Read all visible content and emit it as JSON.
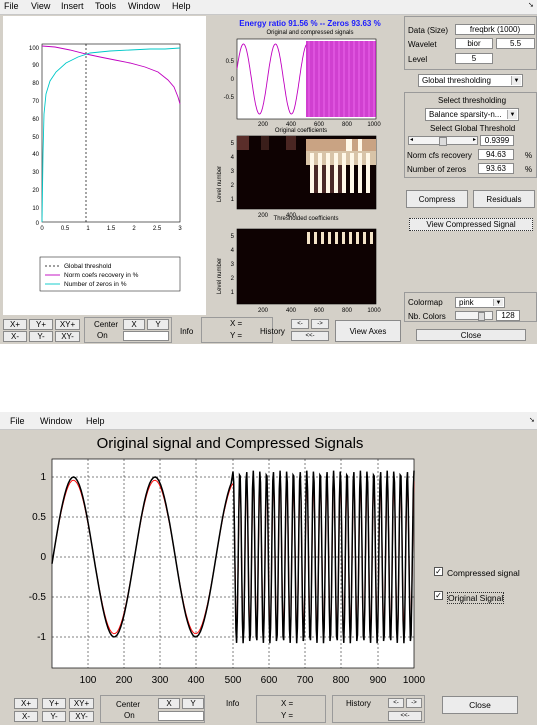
{
  "window1": {
    "menu": [
      "File",
      "View",
      "Insert",
      "Tools",
      "Window",
      "Help"
    ],
    "left_axes": {
      "y_ticks": [
        "100",
        "90",
        "80",
        "70",
        "60",
        "50",
        "40",
        "30",
        "20",
        "10",
        "0"
      ],
      "x_ticks": [
        "0",
        "0.5",
        "1",
        "1.5",
        "2",
        "2.5",
        "3"
      ],
      "legend": [
        "Global threshold",
        "Norm coefs recovery in %",
        "Number of zeros in %"
      ],
      "colors": {
        "threshold": "#000000",
        "recovery": "#c000c0",
        "zeros": "#00c8c8"
      }
    },
    "energy_title": "Energy ratio 91.56 % -- Zeros 93.63 %",
    "signals_title": "Original and compressed signals",
    "signals_y_ticks": [
      "0.5",
      "0",
      "-0.5"
    ],
    "signals_x_ticks": [
      "200",
      "400",
      "600",
      "800",
      "1000"
    ],
    "orig_coef_title": "Original coefficients",
    "thr_coef_title": "Thresholded coefficients",
    "level_label": "Level number",
    "level_ticks": [
      "5",
      "4",
      "3",
      "2",
      "1"
    ],
    "coef_x_ticks": [
      "200",
      "400",
      "600",
      "800",
      "1000"
    ],
    "panel": {
      "data_label": "Data (Size)",
      "data_value": "freqbrk (1000)",
      "wavelet_label": "Wavelet",
      "wavelet_value": "bior",
      "wavelet_order": "5.5",
      "level_label": "Level",
      "level_value": "5",
      "method": "Global thresholding",
      "select_thr_label": "Select thresholding",
      "select_thr_value": "Balance sparsity-n...",
      "select_global_label": "Select Global Threshold",
      "threshold_value": "0.9399",
      "norm_label": "Norm cfs recovery",
      "norm_value": "94.63",
      "norm_unit": "%",
      "zeros_label": "Number of zeros",
      "zeros_value": "93.63",
      "zeros_unit": "%",
      "compress": "Compress",
      "residuals": "Residuals",
      "view_compressed": "View Compressed Signal",
      "colormap_label": "Colormap",
      "colormap_value": "pink",
      "nbcolors_label": "Nb. Colors",
      "nbcolors_value": "128",
      "close": "Close"
    },
    "bottom": {
      "xp": "X+",
      "yp": "Y+",
      "xyp": "XY+",
      "xm": "X-",
      "ym": "Y-",
      "xym": "XY-",
      "center": "Center",
      "on": "On",
      "x": "X",
      "y": "Y",
      "info": "Info",
      "xeq": "X =",
      "yeq": "Y =",
      "history": "History",
      "hist_prev": "<-",
      "hist_next": "->",
      "hist_back": "<<-",
      "view_axes": "View Axes"
    }
  },
  "window2": {
    "menu": [
      "File",
      "Window",
      "Help"
    ],
    "title": "Original signal and Compressed Signals",
    "y_ticks": [
      "1",
      "0.5",
      "0",
      "-0.5",
      "-1"
    ],
    "x_ticks": [
      "100",
      "200",
      "300",
      "400",
      "500",
      "600",
      "700",
      "800",
      "900",
      "1000"
    ],
    "checkbox_compressed": "Compressed signal",
    "checkbox_original": "Original Signal",
    "checked_mark": "✓",
    "colors": {
      "original": "#ff0000",
      "compressed": "#000000"
    },
    "bottom": {
      "xp": "X+",
      "yp": "Y+",
      "xyp": "XY+",
      "xm": "X-",
      "ym": "Y-",
      "xym": "XY-",
      "center": "Center",
      "on": "On",
      "x": "X",
      "y": "Y",
      "info": "Info",
      "xeq": "X =",
      "yeq": "Y =",
      "history": "History",
      "hist_prev": "<-",
      "hist_next": "->",
      "hist_back": "<<-",
      "close": "Close"
    }
  }
}
